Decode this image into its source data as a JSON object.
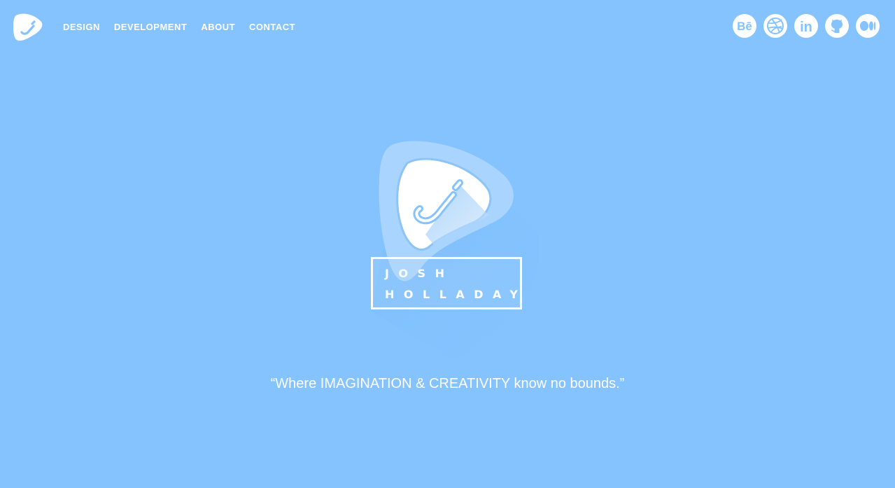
{
  "header": {
    "logo_icon": "j-guitar-pick-logo-icon",
    "nav": [
      {
        "label": "DESIGN"
      },
      {
        "label": "DEVELOPMENT"
      },
      {
        "label": "ABOUT"
      },
      {
        "label": "CONTACT"
      }
    ],
    "social": [
      {
        "icon": "behance-icon",
        "glyph": "Bē"
      },
      {
        "icon": "dribbble-icon"
      },
      {
        "icon": "linkedin-icon",
        "glyph": "in"
      },
      {
        "icon": "github-icon"
      },
      {
        "icon": "medium-icon"
      }
    ]
  },
  "hero": {
    "emblem_icon": "j-guitar-pick-emblem-icon",
    "name_first": "JOSH",
    "name_last": "HOLLADAY",
    "tagline": "“Where IMAGINATION & CREATIVITY know no bounds.”"
  },
  "colors": {
    "background": "#84c3fe",
    "accent": "#84c3fe",
    "foreground": "#ffffff"
  }
}
